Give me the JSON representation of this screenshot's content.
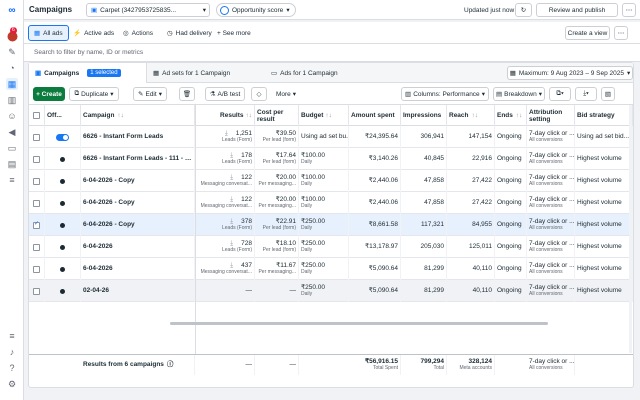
{
  "topbar": {
    "title": "Campaigns",
    "account": "Carpet (3427953725835...",
    "opportunity": "Opportunity score",
    "updated": "Updated just now",
    "review": "Review and publish"
  },
  "views": {
    "all_ads": "All ads",
    "active_ads": "Active ads",
    "actions": "Actions",
    "had_delivery": "Had delivery",
    "see_more": "+ See more",
    "create_view": "Create a view"
  },
  "search": {
    "placeholder": "Search to filter by name, ID or metrics"
  },
  "level_tabs": {
    "campaigns": "Campaigns",
    "selected": "1 selected",
    "adsets": "Ad sets for 1 Campaign",
    "ads": "Ads for 1 Campaign",
    "date_range": "Maximum: 9 Aug 2023 – 9 Sep 2025"
  },
  "toolbar": {
    "create": "+ Create",
    "duplicate": "Duplicate",
    "edit": "Edit",
    "ab_test": "A/B test",
    "more": "More",
    "columns": "Columns: Performance",
    "breakdown": "Breakdown"
  },
  "headers": {
    "off_on": "Off...",
    "campaign": "Campaign",
    "results": "Results",
    "cost": "Cost per result",
    "budget": "Budget",
    "amount": "Amount spent",
    "impressions": "Impressions",
    "reach": "Reach",
    "ends": "Ends",
    "attribution": "Attribution setting",
    "bid": "Bid strategy"
  },
  "rows": [
    {
      "name": "6626 - Instant Form Leads",
      "on": true,
      "results": "1,251",
      "results_sub": "Leads (Form)",
      "cost": "₹39.50",
      "cost_sub": "Per lead (form)",
      "budget": "Using ad set bu...",
      "budget_sub": "",
      "amount": "₹24,395.64",
      "impressions": "306,941",
      "reach": "147,154",
      "ends": "Ongoing",
      "attr": "7-day click or ...",
      "attr_sub": "All conversions",
      "bid": "Using ad set bid..."
    },
    {
      "name": "6626 - Instant Form Leads - 111 - punjab",
      "on": false,
      "results": "178",
      "results_sub": "Leads (Form)",
      "cost": "₹17.64",
      "cost_sub": "Per lead (form)",
      "budget": "₹100.00",
      "budget_sub": "Daily",
      "amount": "₹3,140.26",
      "impressions": "40,845",
      "reach": "22,916",
      "ends": "Ongoing",
      "attr": "7-day click or ...",
      "attr_sub": "All conversions",
      "bid": "Highest volume"
    },
    {
      "name": "6-04-2026 - Copy",
      "on": false,
      "results": "122",
      "results_sub": "Messaging conversat...",
      "cost": "₹20.00",
      "cost_sub": "Per messaging...",
      "budget": "₹100.00",
      "budget_sub": "Daily",
      "amount": "₹2,440.06",
      "impressions": "47,858",
      "reach": "27,422",
      "ends": "Ongoing",
      "attr": "7-day click or ...",
      "attr_sub": "All conversions",
      "bid": "Highest volume"
    },
    {
      "name": "6-04-2026 - Copy",
      "on": false,
      "results": "122",
      "results_sub": "Messaging conversat...",
      "cost": "₹20.00",
      "cost_sub": "Per messaging...",
      "budget": "₹100.00",
      "budget_sub": "Daily",
      "amount": "₹2,440.06",
      "impressions": "47,858",
      "reach": "27,422",
      "ends": "Ongoing",
      "attr": "7-day click or ...",
      "attr_sub": "All conversions",
      "bid": "Highest volume"
    },
    {
      "name": "6-04-2026 - Copy",
      "on": false,
      "selected": true,
      "results": "378",
      "results_sub": "Leads (Form)",
      "cost": "₹22.91",
      "cost_sub": "Per lead (form)",
      "budget": "₹250.00",
      "budget_sub": "Daily",
      "amount": "₹8,661.58",
      "impressions": "117,321",
      "reach": "84,955",
      "ends": "Ongoing",
      "attr": "7-day click or ...",
      "attr_sub": "All conversions",
      "bid": "Highest volume"
    },
    {
      "name": "6-04-2026",
      "on": false,
      "results": "728",
      "results_sub": "Leads (Form)",
      "cost": "₹18.10",
      "cost_sub": "Per lead (form)",
      "budget": "₹250.00",
      "budget_sub": "Daily",
      "amount": "₹13,178.97",
      "impressions": "205,030",
      "reach": "125,011",
      "ends": "Ongoing",
      "attr": "7-day click or ...",
      "attr_sub": "All conversions",
      "bid": "Highest volume"
    },
    {
      "name": "6-04-2026",
      "on": false,
      "results": "437",
      "results_sub": "Messaging conversat...",
      "cost": "₹11.67",
      "cost_sub": "Per messaging...",
      "budget": "₹250.00",
      "budget_sub": "Daily",
      "amount": "₹5,090.64",
      "impressions": "81,299",
      "reach": "40,110",
      "ends": "Ongoing",
      "attr": "7-day click or ...",
      "attr_sub": "All conversions",
      "bid": "Highest volume"
    },
    {
      "name": "02-04-26",
      "on": false,
      "results": "—",
      "results_sub": "",
      "cost": "—",
      "cost_sub": "",
      "budget": "₹250.00",
      "budget_sub": "Daily",
      "amount": "₹5,090.64",
      "impressions": "81,299",
      "reach": "40,110",
      "ends": "Ongoing",
      "attr": "7-day click or ...",
      "attr_sub": "All conversions",
      "bid": "Highest volume"
    }
  ],
  "totals": {
    "label": "Results from 6 campaigns",
    "results": "—",
    "cost": "—",
    "amount": "₹56,916.15",
    "amount_sub": "Total Spent",
    "impressions": "799,294",
    "impressions_sub": "Total",
    "reach": "328,124",
    "reach_sub": "Meta accounts",
    "attr": "7-day click or ...",
    "attr_sub": "All conversions"
  },
  "rail": {
    "notifications": "6"
  }
}
